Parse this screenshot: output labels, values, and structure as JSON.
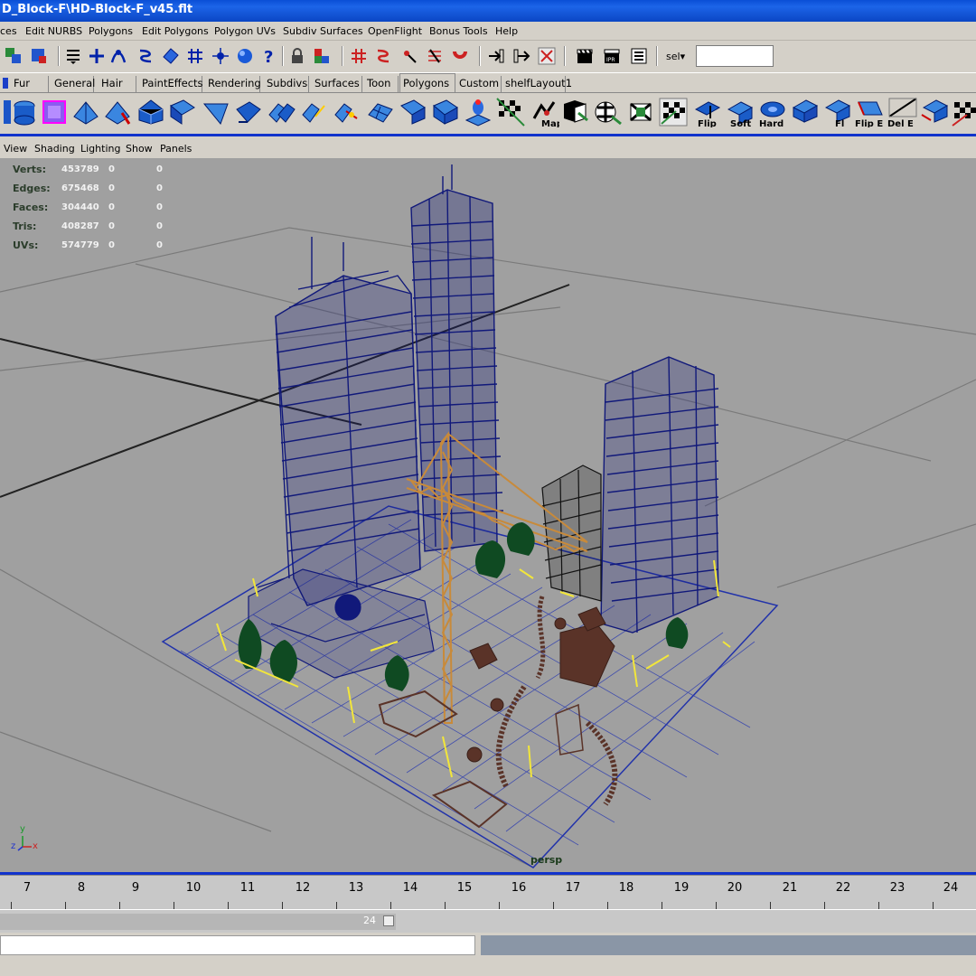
{
  "window": {
    "title": "D_Block-F\\HD-Block-F_v45.flt"
  },
  "menu": [
    "ces",
    "Edit NURBS",
    "Polygons",
    "Edit Polygons",
    "Polygon UVs",
    "Subdiv Surfaces",
    "OpenFlight",
    "Bonus Tools",
    "Help"
  ],
  "statusline": {
    "sel_label": "sel",
    "sel_value": ""
  },
  "shelf_tabs": [
    "Fur",
    "General",
    "Hair",
    "PaintEffects",
    "Rendering",
    "Subdivs",
    "Surfaces",
    "Toon",
    "Polygons",
    "Custom",
    "shelfLayout1"
  ],
  "shelf_active_tab": "Polygons",
  "shelf_labels": {
    "map": "Map",
    "flip": "Flip",
    "soft": "Soft",
    "hard": "Hard",
    "fl": "Fl",
    "flip_e": "Flip E",
    "del_e": "Del E"
  },
  "panel_menu": [
    "View",
    "Shading",
    "Lighting",
    "Show",
    "Panels"
  ],
  "hud": [
    {
      "label": "Verts:",
      "value": "453789",
      "a": "0",
      "b": "0"
    },
    {
      "label": "Edges:",
      "value": "675468",
      "a": "0",
      "b": "0"
    },
    {
      "label": "Faces:",
      "value": "304440",
      "a": "0",
      "b": "0"
    },
    {
      "label": "Tris:",
      "value": "408287",
      "a": "0",
      "b": "0"
    },
    {
      "label": "UVs:",
      "value": "574779",
      "a": "0",
      "b": "0"
    }
  ],
  "axis": {
    "x": "x",
    "y": "y",
    "z": "z"
  },
  "camera_label": "persp",
  "timeline": {
    "ticks": [
      "7",
      "8",
      "9",
      "10",
      "11",
      "12",
      "13",
      "14",
      "15",
      "16",
      "17",
      "18",
      "19",
      "20",
      "21",
      "22",
      "23",
      "24"
    ]
  },
  "range": {
    "end": "24"
  },
  "colors": {
    "title_bar": "#0b4fd6",
    "wire_blue": "#11197a",
    "crane": "#c88a3a",
    "props": "#5a3328",
    "lamp": "#f2e63a",
    "tree": "#0f4a22",
    "viewport": "#a0a0a0"
  }
}
